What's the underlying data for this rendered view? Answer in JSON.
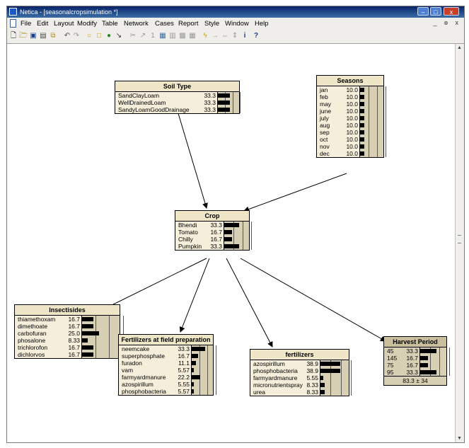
{
  "window": {
    "title": "Netica - [seasonalcropsimulation *]",
    "min_glyph": "–",
    "max_glyph": "□",
    "close_glyph": "x",
    "mdi_controls": "_ ɵ x"
  },
  "menu": [
    "File",
    "Edit",
    "Layout",
    "Modify",
    "Table",
    "Network",
    "Cases",
    "Report",
    "Style",
    "Window",
    "Help"
  ],
  "toolbar_icons": [
    {
      "name": "new-icon",
      "glyph": "🗋"
    },
    {
      "name": "open-icon",
      "glyph": "🗁"
    },
    {
      "name": "save-icon",
      "glyph": "▣"
    },
    {
      "name": "print-icon",
      "glyph": "▤"
    },
    {
      "name": "copy-icon",
      "glyph": "⧉"
    },
    {
      "name": "undo-icon",
      "glyph": "↶"
    },
    {
      "name": "redo-icon",
      "glyph": "↷"
    },
    {
      "name": "oval-node-icon",
      "glyph": "○"
    },
    {
      "name": "rect-node-icon",
      "glyph": "□"
    },
    {
      "name": "filled-node-icon",
      "glyph": "●"
    },
    {
      "name": "arrow-link-icon",
      "glyph": "↘"
    },
    {
      "name": "delete-link-icon",
      "glyph": "✂"
    },
    {
      "name": "select-icon",
      "glyph": "↗"
    },
    {
      "name": "number-icon",
      "glyph": "1"
    },
    {
      "name": "compile-icon",
      "glyph": "▦"
    },
    {
      "name": "chart-icon",
      "glyph": "▥"
    },
    {
      "name": "grid-icon",
      "glyph": "▩"
    },
    {
      "name": "table-icon",
      "glyph": "▦"
    },
    {
      "name": "lightning-icon",
      "glyph": "ϟ"
    },
    {
      "name": "arrow-right-icon",
      "glyph": "→"
    },
    {
      "name": "expand-icon",
      "glyph": "⇔"
    },
    {
      "name": "shrink-icon",
      "glyph": "⇕"
    },
    {
      "name": "info-icon",
      "glyph": "i"
    },
    {
      "name": "help-icon",
      "glyph": "?"
    }
  ],
  "nodes": {
    "soil": {
      "title": "Soil Type",
      "states": [
        {
          "name": "SandClayLoam",
          "value": "33.3",
          "p": 0.333
        },
        {
          "name": "WellDrainedLoam",
          "value": "33.3",
          "p": 0.333
        },
        {
          "name": "SandyLoamGoodDrainage",
          "value": "33.3",
          "p": 0.333
        }
      ]
    },
    "seasons": {
      "title": "Seasons",
      "states": [
        {
          "name": "jan",
          "value": "10.0",
          "p": 0.1
        },
        {
          "name": "feb",
          "value": "10.0",
          "p": 0.1
        },
        {
          "name": "may",
          "value": "10.0",
          "p": 0.1
        },
        {
          "name": "june",
          "value": "10.0",
          "p": 0.1
        },
        {
          "name": "july",
          "value": "10.0",
          "p": 0.1
        },
        {
          "name": "aug",
          "value": "10.0",
          "p": 0.1
        },
        {
          "name": "sep",
          "value": "10.0",
          "p": 0.1
        },
        {
          "name": "oct",
          "value": "10.0",
          "p": 0.1
        },
        {
          "name": "nov",
          "value": "10.0",
          "p": 0.1
        },
        {
          "name": "dec",
          "value": "10.0",
          "p": 0.1
        }
      ]
    },
    "crop": {
      "title": "Crop",
      "states": [
        {
          "name": "Bhendi",
          "value": "33.3",
          "p": 0.333
        },
        {
          "name": "Tomato",
          "value": "16.7",
          "p": 0.167
        },
        {
          "name": "Chilly",
          "value": "16.7",
          "p": 0.167
        },
        {
          "name": "Pumpkin",
          "value": "33.3",
          "p": 0.333
        }
      ]
    },
    "insecticides": {
      "title": "Insectisides",
      "states": [
        {
          "name": "thiamethoxam",
          "value": "16.7",
          "p": 0.167
        },
        {
          "name": "dimethoate",
          "value": "16.7",
          "p": 0.167
        },
        {
          "name": "carbofuran",
          "value": "25.0",
          "p": 0.25
        },
        {
          "name": "phosalone",
          "value": "8.33",
          "p": 0.0833
        },
        {
          "name": "trichlorofon",
          "value": "16.7",
          "p": 0.167
        },
        {
          "name": "dichlorvos",
          "value": "16.7",
          "p": 0.167
        }
      ]
    },
    "fert_prep": {
      "title": "Fertilizers at field preparation",
      "states": [
        {
          "name": "neemcake",
          "value": "33.3",
          "p": 0.333
        },
        {
          "name": "superphosphate",
          "value": "16.7",
          "p": 0.167
        },
        {
          "name": "furadon",
          "value": "11.1",
          "p": 0.111
        },
        {
          "name": "vam",
          "value": "5.57",
          "p": 0.0557
        },
        {
          "name": "farmyardmanure",
          "value": "22.2",
          "p": 0.222
        },
        {
          "name": "azospirillum",
          "value": "5.55",
          "p": 0.0555
        },
        {
          "name": "phosphobacteria",
          "value": "5.57",
          "p": 0.0557
        }
      ]
    },
    "fertilizers": {
      "title": "fertilizers",
      "states": [
        {
          "name": "azospirillum",
          "value": "38.9",
          "p": 0.389
        },
        {
          "name": "phosphobacteria",
          "value": "38.9",
          "p": 0.389
        },
        {
          "name": "farmyardmanure",
          "value": "5.55",
          "p": 0.0555
        },
        {
          "name": "micronutrientspray",
          "value": "8.33",
          "p": 0.0833
        },
        {
          "name": "urea",
          "value": "8.33",
          "p": 0.0833
        }
      ]
    },
    "harvest": {
      "title": "Harvest Period",
      "states": [
        {
          "name": "45",
          "value": "33.3",
          "p": 0.333
        },
        {
          "name": "145",
          "value": "16.7",
          "p": 0.167
        },
        {
          "name": "75",
          "value": "16.7",
          "p": 0.167
        },
        {
          "name": "95",
          "value": "33.3",
          "p": 0.333
        }
      ],
      "footer": "83.3 ± 34"
    }
  }
}
